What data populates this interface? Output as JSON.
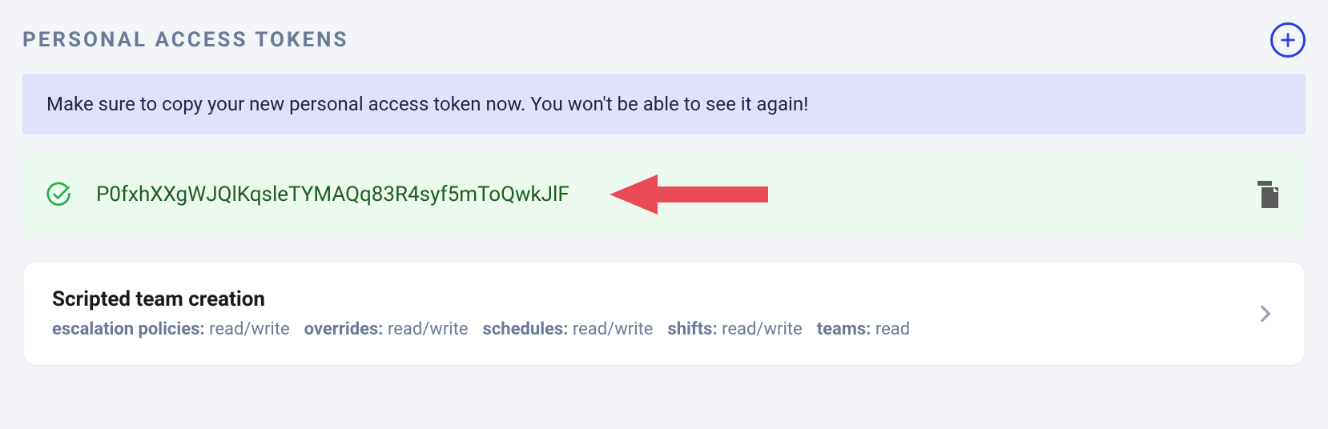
{
  "header": {
    "title": "Personal Access Tokens"
  },
  "notice": {
    "text": "Make sure to copy your new personal access token now. You won't be able to see it again!"
  },
  "token": {
    "value": "P0fxhXXgWJQlKqsleTYMAQq83R4syf5mToQwkJlF"
  },
  "card": {
    "name": "Scripted team creation",
    "scopes": [
      {
        "key": "escalation policies:",
        "val": " read/write"
      },
      {
        "key": "overrides:",
        "val": " read/write"
      },
      {
        "key": "schedules:",
        "val": " read/write"
      },
      {
        "key": "shifts:",
        "val": " read/write"
      },
      {
        "key": "teams:",
        "val": " read"
      }
    ]
  }
}
